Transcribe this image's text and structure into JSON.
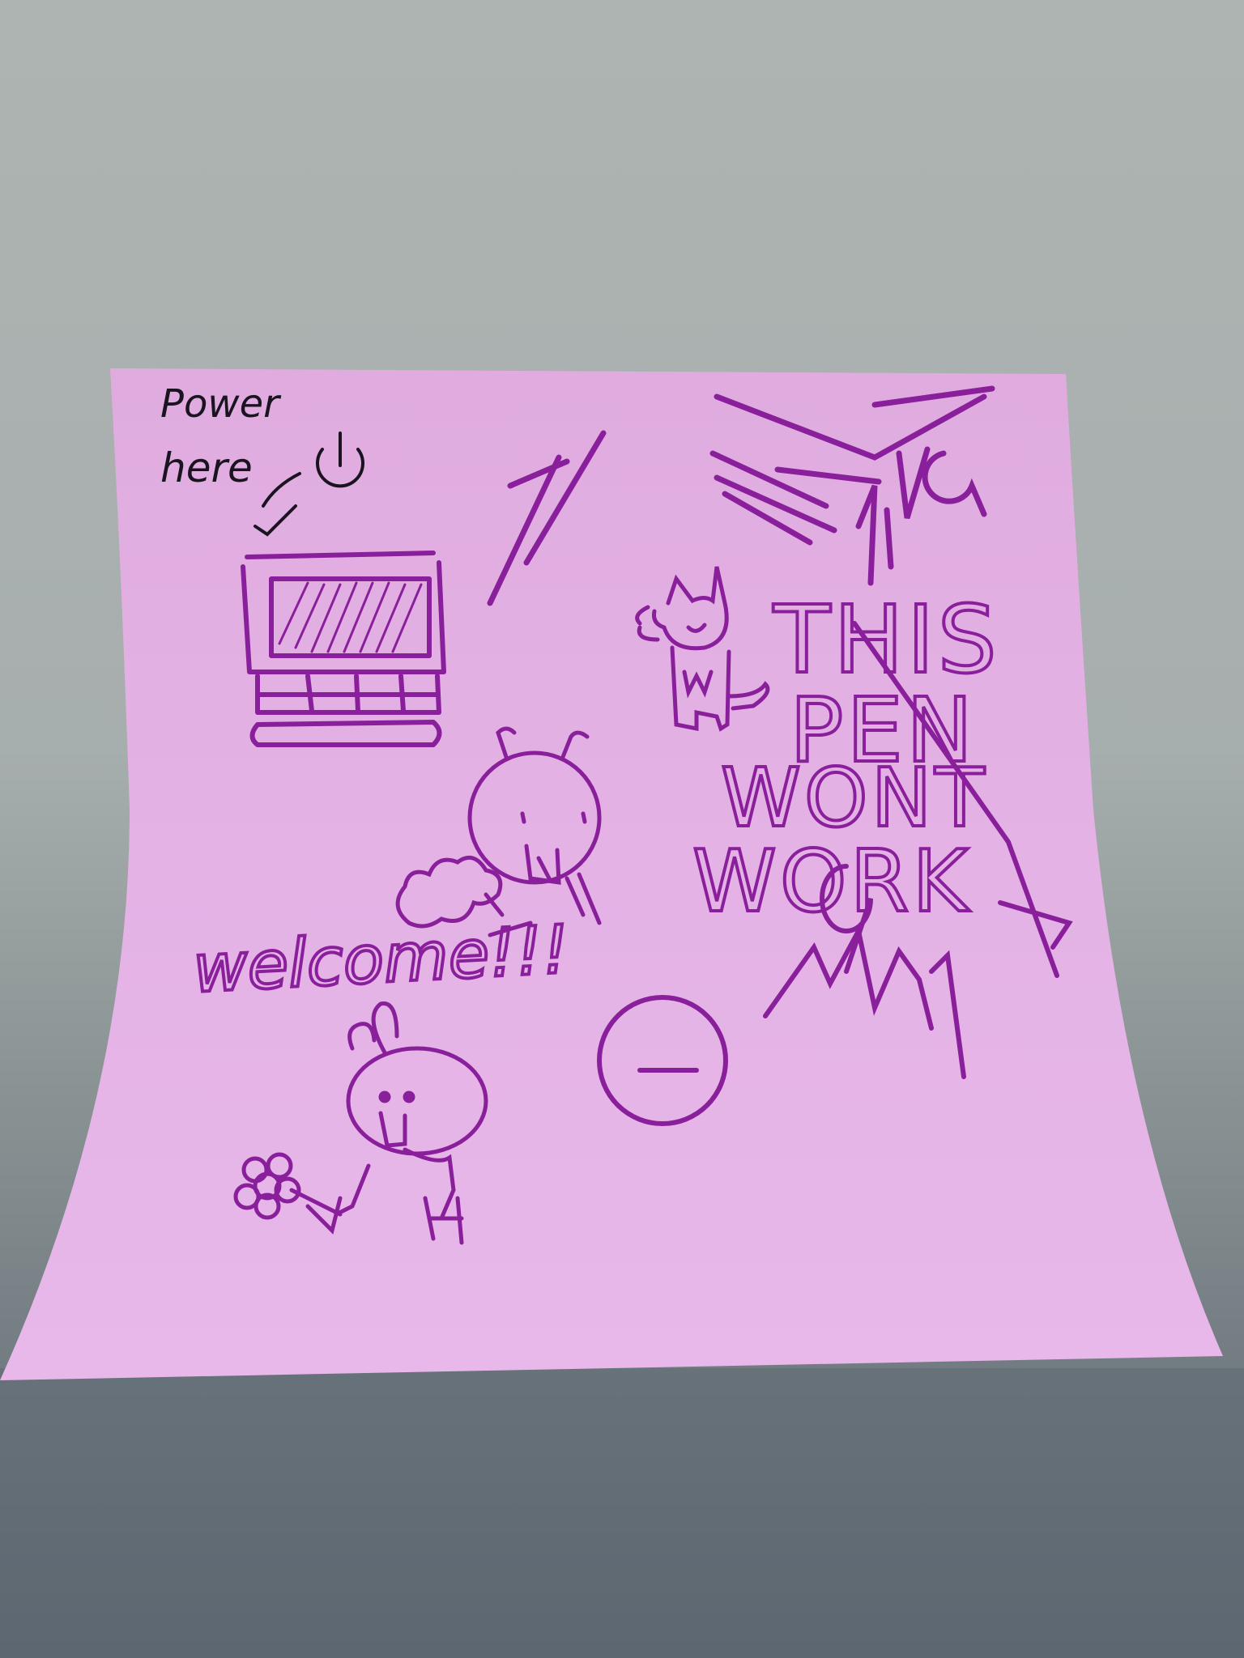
{
  "photo": {
    "background_top": "#a9b0ad",
    "background_bottom": "#5d6770",
    "note_color": "#e2b0e4",
    "ink_color": "#8a1f9c",
    "pencil_color": "#1a1420"
  },
  "note": {
    "power_label_line1": "Power",
    "power_label_line2": "here",
    "welcome_text": "welcome!!!",
    "crossed_text_line1": "THIS",
    "crossed_text_line2": "PEN",
    "crossed_text_line3": "WONT",
    "crossed_text_line4": "WORK"
  },
  "drawings": [
    "power-button-icon",
    "laptop-icon",
    "cat",
    "bug-creature",
    "cloud",
    "bunny",
    "flower",
    "neutral-face",
    "scribble-marks"
  ]
}
